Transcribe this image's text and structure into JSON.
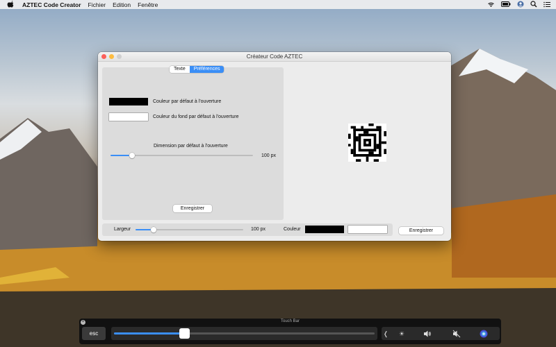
{
  "menubar": {
    "app_name": "AZTEC Code Creator",
    "items": [
      "Fichier",
      "Edition",
      "Fenêtre"
    ]
  },
  "window": {
    "title": "Créateur Code AZTEC",
    "tabs": [
      {
        "label": "Texte",
        "active": false
      },
      {
        "label": "Préférences",
        "active": true
      }
    ],
    "preferences": {
      "default_color_label": "Couleur par défaut à l'ouverture",
      "default_color": "#000000",
      "default_bg_label": "Couleur du fond par défaut à l'ouverture",
      "default_bg_color": "#ffffff",
      "dimension_label": "Dimension par défaut à l'ouverture",
      "dimension_value": "100 px",
      "dimension_slider_fraction": 0.15,
      "save_label": "Enregistrer"
    },
    "bottom_bar": {
      "width_label": "Largeur",
      "width_value": "100 px",
      "width_slider_fraction": 0.17,
      "color_label": "Couleur",
      "foreground_color": "#000000",
      "background_color": "#ffffff",
      "save_label": "Enregistrer"
    }
  },
  "touchbar": {
    "title": "Touch Bar",
    "esc_label": "esc",
    "slider_fraction": 0.27,
    "icons": [
      "chevron-left-icon",
      "brightness-icon",
      "volume-icon",
      "mute-icon",
      "siri-icon"
    ]
  },
  "colors": {
    "accent": "#3a8ef6"
  }
}
